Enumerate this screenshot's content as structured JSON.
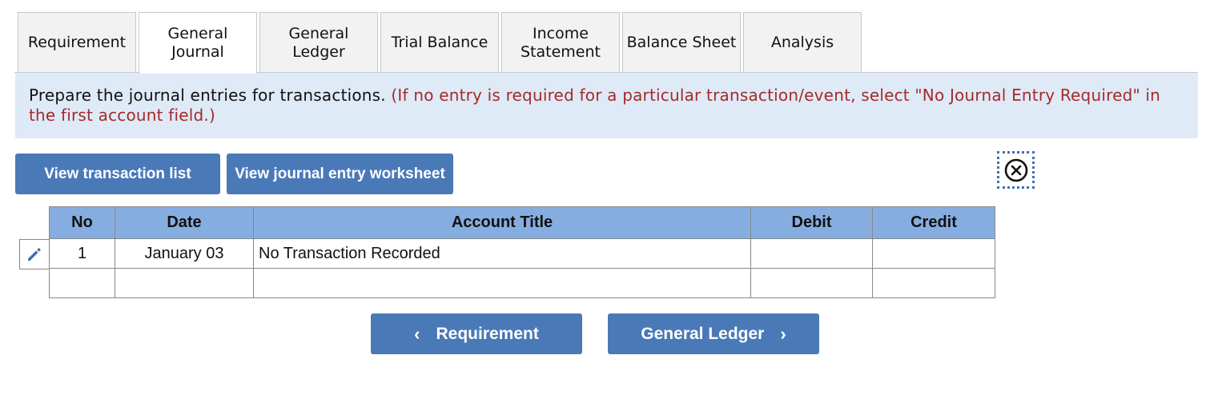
{
  "tabs": [
    {
      "label": "Requirement"
    },
    {
      "label": "General\nJournal"
    },
    {
      "label": "General\nLedger"
    },
    {
      "label": "Trial Balance"
    },
    {
      "label": "Income\nStatement"
    },
    {
      "label": "Balance Sheet"
    },
    {
      "label": "Analysis"
    }
  ],
  "active_tab": "General Journal",
  "instructions": {
    "main": "Prepare the journal entries for transactions. ",
    "note": "(If no entry is required for a particular transaction/event, select \"No Journal Entry Required\" in the first account field.)"
  },
  "buttons": {
    "view_transactions": "View transaction list",
    "view_worksheet": "View journal entry worksheet"
  },
  "table": {
    "headers": [
      "No",
      "Date",
      "Account Title",
      "Debit",
      "Credit"
    ],
    "rows": [
      {
        "no": "1",
        "date": "January 03",
        "account": "No Transaction Recorded",
        "debit": "",
        "credit": ""
      },
      {
        "no": "",
        "date": "",
        "account": "",
        "debit": "",
        "credit": ""
      }
    ]
  },
  "nav": {
    "prev_label": "Requirement",
    "next_label": "General Ledger"
  },
  "colors": {
    "accent": "#4a79b8",
    "header_bg": "#86ade0",
    "instruction_bg": "#dfeaf7",
    "note_text": "#a52a2a"
  },
  "icons": {
    "close": "close-circle-icon",
    "edit": "pencil-icon",
    "prev": "chevron-left-icon",
    "next": "chevron-right-icon"
  }
}
